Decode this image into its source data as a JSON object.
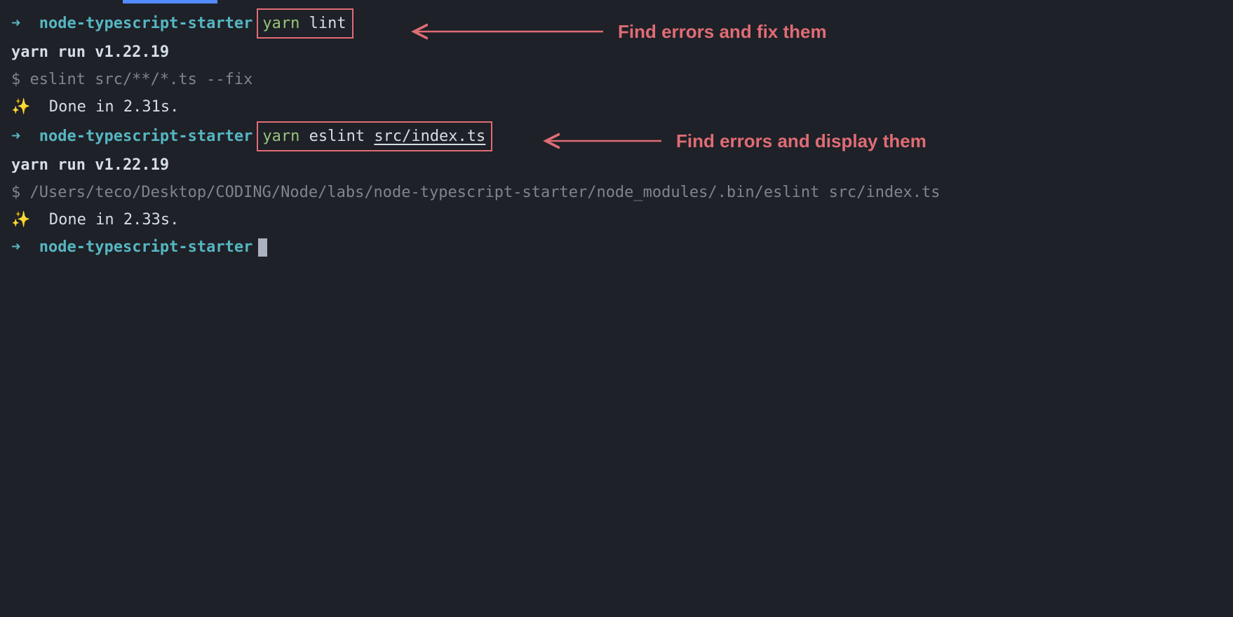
{
  "prompt": {
    "arrow": "➜",
    "project": "node-typescript-starter"
  },
  "block1": {
    "cmd_yarn": "yarn",
    "cmd_rest": " lint",
    "out_yarn_run": "yarn run v1.22.19",
    "out_dollar": "$ eslint src/**/*.ts --fix",
    "out_sparkle": "✨",
    "out_done": "  Done in 2.31s."
  },
  "block2": {
    "cmd_yarn": "yarn",
    "cmd_rest_a": " eslint ",
    "cmd_rest_b": "src/index.ts",
    "out_yarn_run": "yarn run v1.22.19",
    "out_dollar": "$ /Users/teco/Desktop/CODING/Node/labs/node-typescript-starter/node_modules/.bin/eslint src/index.ts",
    "out_sparkle": "✨",
    "out_done": "  Done in 2.33s."
  },
  "annotations": {
    "a1": "Find errors and fix them",
    "a2": "Find errors and display them"
  }
}
